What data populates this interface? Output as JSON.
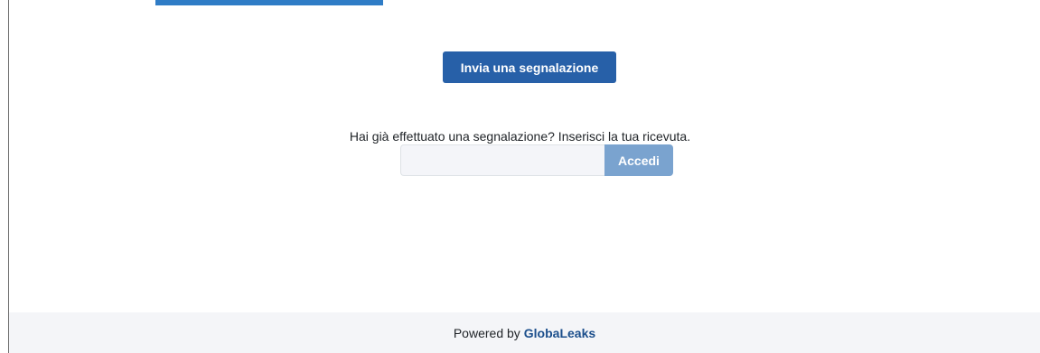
{
  "whistleblowing": {
    "submit_label": "Invia una segnalazione",
    "receipt_prompt": "Hai già effettuato una segnalazione? Inserisci la tua ricevuta.",
    "receipt_input_value": "",
    "login_label": "Accedi"
  },
  "footer": {
    "powered_by": "Powered by",
    "brand": "GlobaLeaks"
  },
  "colors": {
    "primary": "#2760a8",
    "primary_disabled": "#7aa3cf",
    "brand_link": "#1c4f8c",
    "footer_bg": "#f4f5f8",
    "banner": "#2f7cc6"
  }
}
